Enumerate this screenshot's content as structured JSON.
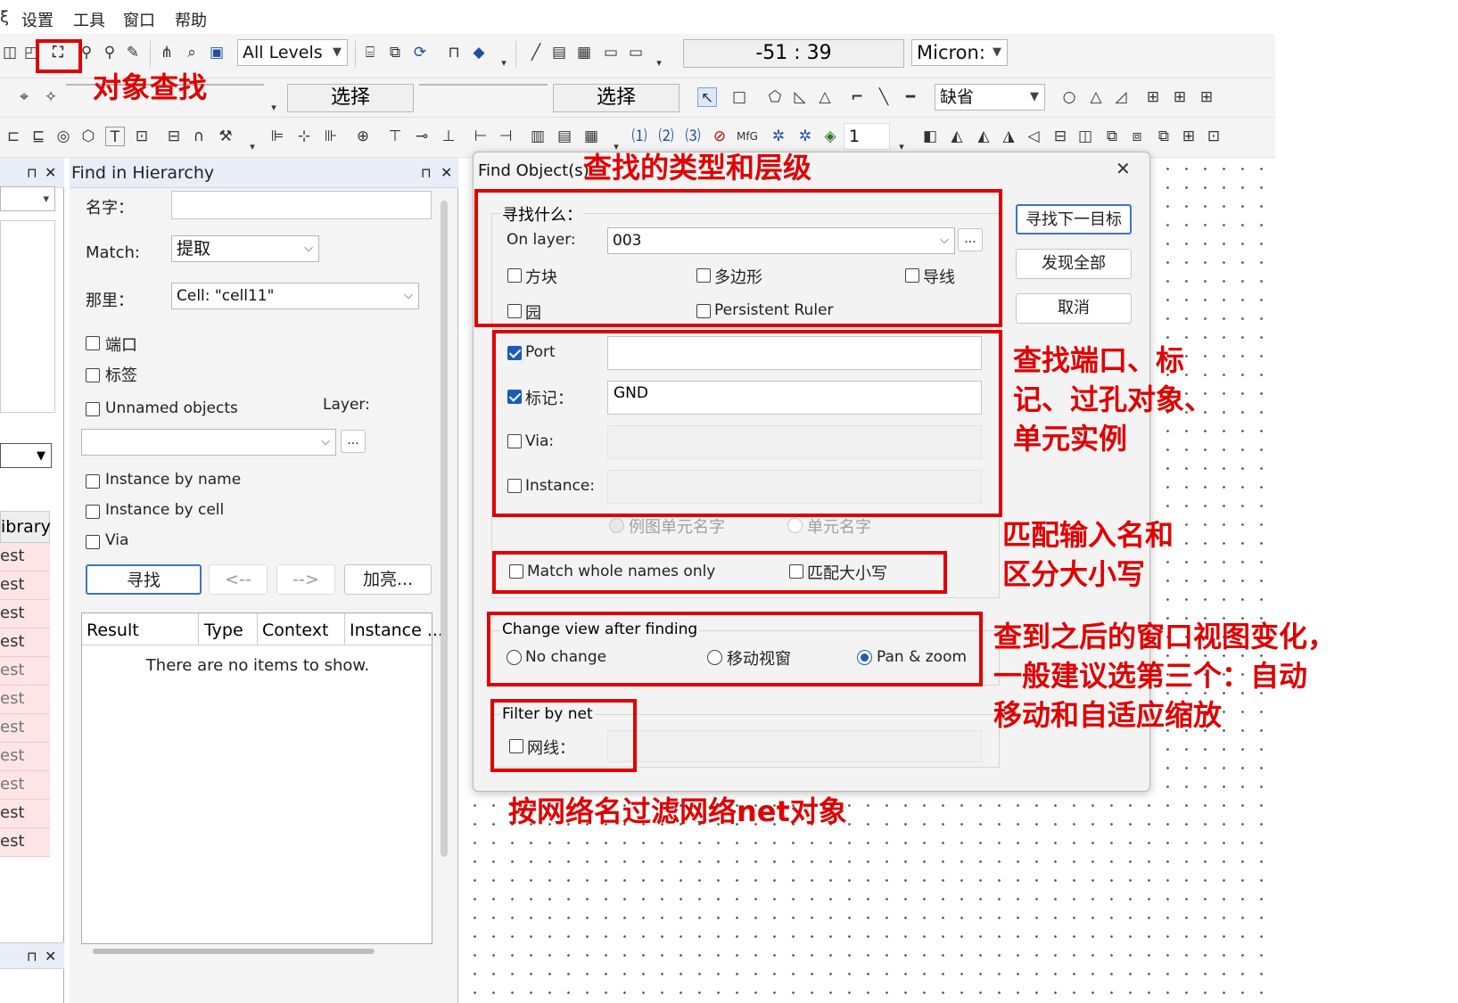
{
  "menu": [
    "设置",
    "工具",
    "窗口",
    "帮助"
  ],
  "menu_lead": "ξ",
  "toolbar1": {
    "levels_combo": "All Levels",
    "coord_readout": "-51 : 39",
    "units_combo": "Micron:"
  },
  "toolbar2": {
    "select_field_1": "选择",
    "select_field_2": "选择",
    "default_combo": "缺省"
  },
  "toolbar3": {
    "layer_num": "1"
  },
  "left_strip": {
    "library_label": "ibrary",
    "items": [
      "est",
      "est",
      "est",
      "est",
      "est",
      "est",
      "est",
      "est",
      "est",
      "est",
      "est"
    ]
  },
  "find_hierarchy": {
    "title": "Find in Hierarchy",
    "name_label": "名字：",
    "match_label": "Match:",
    "match_value": "提取",
    "where_label": "那里：",
    "where_value": "Cell: \"cell11\"",
    "port_label": "端口",
    "tag_label": "标签",
    "unnamed_label": "Unnamed objects",
    "layer_label": "Layer:",
    "more_btn": "...",
    "instance_name_label": "Instance by name",
    "instance_cell_label": "Instance by cell",
    "via_label": "Via",
    "find_btn": "寻找",
    "prev_btn": "<--",
    "next_btn": "-->",
    "highlight_btn": "加亮...",
    "columns": [
      "Result",
      "Type",
      "Context",
      "Instance ..."
    ],
    "empty_text": "There are no items to show."
  },
  "find_dialog": {
    "title": "Find Object(s)",
    "close": "✕",
    "what_group": "寻找什么：",
    "on_layer_label": "On layer:",
    "on_layer_value": "003",
    "more_btn": "...",
    "box_label": "方块",
    "polygon_label": "多边形",
    "wire_label": "导线",
    "circle_label": "园",
    "ruler_label": "Persistent Ruler",
    "port_label": "Port",
    "port_value": "",
    "tag_label": "标记：",
    "tag_value": "GND",
    "via_label": "Via:",
    "instance_label": "Instance:",
    "inst_radio1": "例图单元名字",
    "inst_radio2": "单元名字",
    "match_whole_label": "Match whole names only",
    "match_case_label": "匹配大小写",
    "view_group": "Change view after finding",
    "no_change_label": "No change",
    "move_view_label": "移动视窗",
    "pan_zoom_label": "Pan & zoom",
    "filter_group": "Filter by net",
    "net_label": "网线：",
    "find_next_btn": "寻找下一目标",
    "find_all_btn": "发现全部",
    "cancel_btn": "取消"
  },
  "annotations": {
    "find_object": "对象查找",
    "type_level": "查找的类型和层级",
    "port_tag": "查找端口、标\n记、过孔对象、\n单元实例",
    "match_name": "匹配输入名和\n区分大小写",
    "view_change": "查到之后的窗口视图变化，\n一般建议选第三个：自动\n移动和自适应缩放",
    "net_filter": "按网络名过滤网络net对象"
  },
  "colors": {
    "annotation": "#e00000",
    "checkbox_accent": "#1d5bb8",
    "library_row": "#fde5e6"
  }
}
